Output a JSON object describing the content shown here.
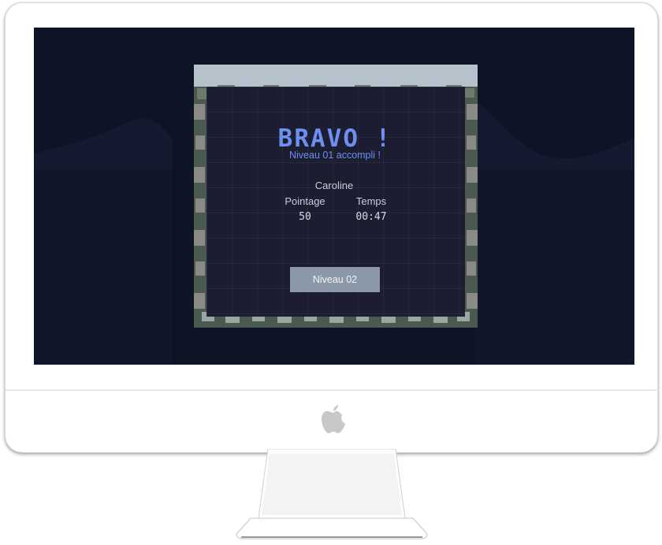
{
  "game": {
    "title": "BRAVO !",
    "subtitle": "Niveau 01 accompli !",
    "player_name": "Caroline",
    "score_label": "Pointage",
    "score_value": "50",
    "time_label": "Temps",
    "time_value": "00:47",
    "next_button_label": "Niveau 02"
  },
  "colors": {
    "accent": "#6d8ff2",
    "background": "#0e1426",
    "panel": "#1c1d31",
    "button": "#8a98a8"
  },
  "icons": {
    "logo": "apple-logo-icon"
  }
}
